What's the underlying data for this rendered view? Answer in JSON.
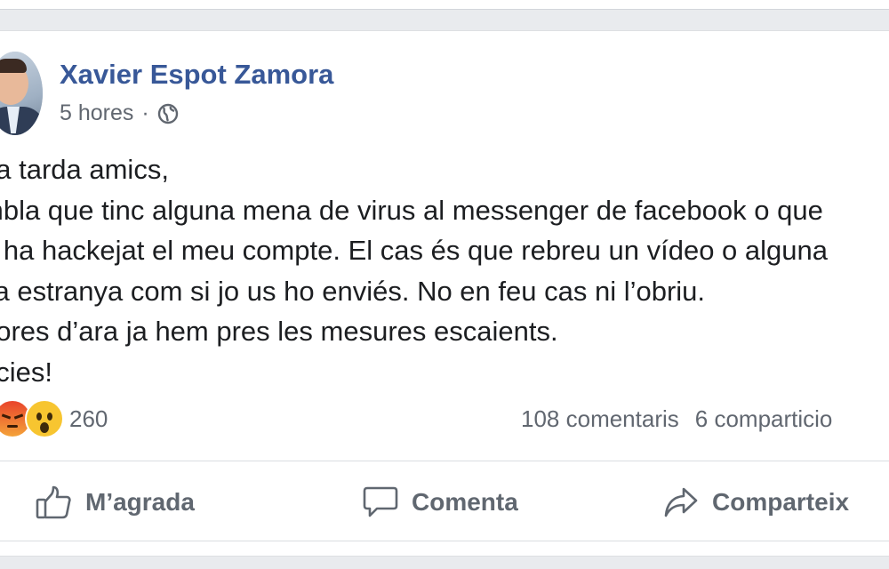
{
  "post": {
    "author": "Xavier Espot Zamora",
    "time": "5 hores",
    "separator": "·",
    "privacy_icon": "globe-icon",
    "body_lines": [
      "na tarda amics,",
      "mbla que tinc alguna mena de virus al messenger de facebook o que",
      "ú ha hackejat el meu compte. El cas és que rebreu un vídeo o alguna",
      "sa estranya com si jo us ho enviés. No en feu cas ni l’obriu.",
      "hores d’ara ja hem pres les mesures escaients.",
      "àcies!"
    ]
  },
  "reactions": {
    "icons": [
      "angry-reaction-icon",
      "wow-reaction-icon"
    ],
    "count": "260"
  },
  "stats": {
    "comments": "108 comentaris",
    "shares": "6 comparticio"
  },
  "actions": {
    "like": "M’agrada",
    "comment": "Comenta",
    "share": "Comparteix"
  },
  "colors": {
    "author_link": "#385898",
    "text": "#1c1e21",
    "secondary": "#616770",
    "action": "#606770"
  }
}
